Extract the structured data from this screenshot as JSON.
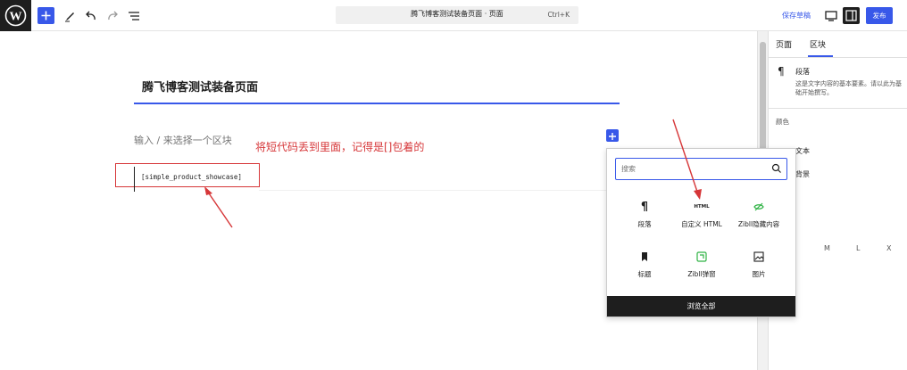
{
  "topbar": {
    "command_title": "腾飞博客测试装备页面 · 页面",
    "command_shortcut": "Ctrl+K",
    "save_draft": "保存草稿",
    "publish": "发布"
  },
  "editor": {
    "page_title": "腾飞博客测试装备页面",
    "placeholder": "输入 / 来选择一个区块",
    "shortcode": "[simple_product_showcase]",
    "annotation": "将短代码丢到里面，记得是[]包着的"
  },
  "sidebar": {
    "tabs": [
      {
        "label": "页面"
      },
      {
        "label": "区块"
      }
    ],
    "block_name": "段落",
    "block_desc": "这是文字内容的基本要素。请以此为基础开始撰写。",
    "color_label": "颜色",
    "color_rows": [
      {
        "label": "文本"
      },
      {
        "label": "背景"
      }
    ],
    "sizes": [
      "M",
      "L",
      "X"
    ]
  },
  "inserter": {
    "search_placeholder": "搜索",
    "blocks": [
      {
        "label": "段落",
        "icon": "paragraph-icon"
      },
      {
        "label": "自定义 HTML",
        "icon": "html-icon",
        "icon_text": "HTML"
      },
      {
        "label": "Zibll隐藏内容",
        "icon": "eye-off-icon"
      },
      {
        "label": "标题",
        "icon": "bookmark-icon"
      },
      {
        "label": "Zibll弹窗",
        "icon": "popup-icon"
      },
      {
        "label": "图片",
        "icon": "image-icon"
      }
    ],
    "browse_all": "浏览全部"
  },
  "colors": {
    "accent": "#3858e9",
    "annotation_red": "#d63638",
    "zibll_green": "#2fb344"
  }
}
